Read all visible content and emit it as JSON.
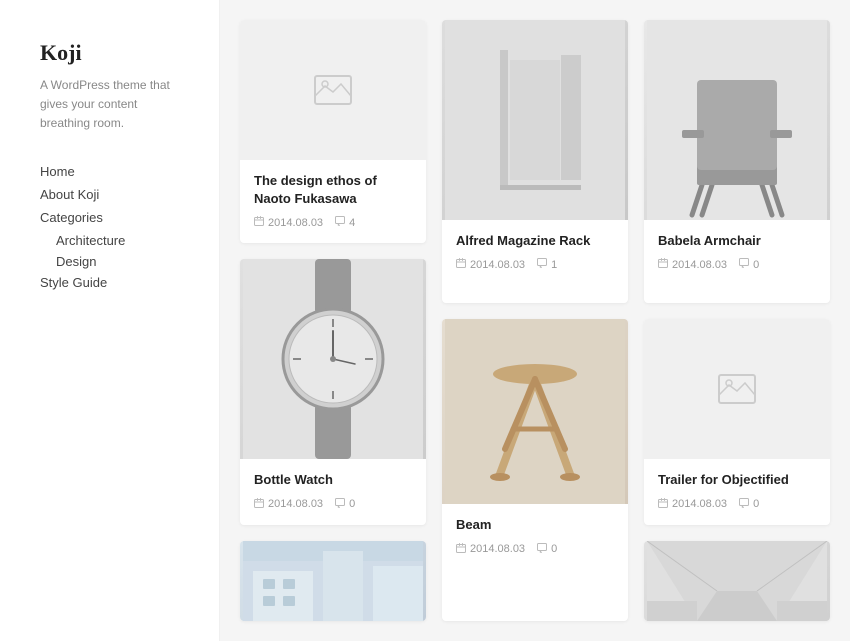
{
  "site": {
    "title": "Koji",
    "description": "A WordPress theme that gives your content breathing room."
  },
  "nav": {
    "items": [
      {
        "label": "Home",
        "id": "home"
      },
      {
        "label": "About Koji",
        "id": "about"
      },
      {
        "label": "Categories",
        "id": "categories"
      },
      {
        "label": "Style Guide",
        "id": "style-guide"
      }
    ],
    "sub_items": [
      {
        "label": "Architecture",
        "id": "architecture"
      },
      {
        "label": "Design",
        "id": "design"
      }
    ]
  },
  "cards": [
    {
      "id": "card-1",
      "title": "The design ethos of Naoto Fukasawa",
      "date": "2014.08.03",
      "comments": "4",
      "image_type": "placeholder",
      "col": 1,
      "row": 1
    },
    {
      "id": "card-2",
      "title": "Alfred Magazine Rack",
      "date": "2014.08.03",
      "comments": "1",
      "image_type": "magazine",
      "col": 2,
      "row": 1
    },
    {
      "id": "card-3",
      "title": "Babela Armchair",
      "date": "2014.08.03",
      "comments": "0",
      "image_type": "chair",
      "col": 3,
      "row": 1
    },
    {
      "id": "card-4",
      "title": "Bottle Watch",
      "date": "2014.08.03",
      "comments": "0",
      "image_type": "watch",
      "col": 1,
      "row": 2
    },
    {
      "id": "card-5",
      "title": "Beam",
      "date": "2014.08.03",
      "comments": "0",
      "image_type": "beam",
      "col": 2,
      "row": 2
    },
    {
      "id": "card-6",
      "title": "Trailer for Objectified",
      "date": "2014.08.03",
      "comments": "0",
      "image_type": "placeholder2",
      "col": 3,
      "row": 2
    },
    {
      "id": "card-7",
      "title": "",
      "date": "",
      "comments": "",
      "image_type": "building",
      "col": 1,
      "row": 3
    },
    {
      "id": "card-8",
      "title": "",
      "date": "",
      "comments": "",
      "image_type": "hallway",
      "col": 3,
      "row": 3
    }
  ],
  "icons": {
    "calendar": "📅",
    "comment": "💬",
    "image_placeholder": "🖼"
  }
}
